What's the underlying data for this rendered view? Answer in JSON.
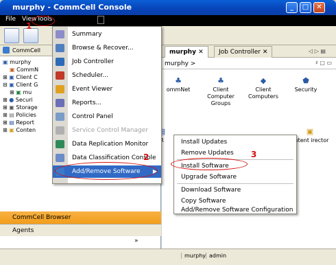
{
  "window": {
    "title": "murphy - CommCell Console",
    "minimize": "_",
    "maximize": "□",
    "close": "✕"
  },
  "menubar": {
    "file": "File",
    "view": "View",
    "tools": "Tools"
  },
  "left_panel": {
    "header": "CommCell",
    "tree": [
      "murphy",
      "CommN",
      "Client C",
      "Client G",
      "mu",
      "Securi",
      "Storage",
      "Policies",
      "Report",
      "Conten"
    ],
    "browser": "CommCell Browser",
    "agents": "Agents",
    "more": "»"
  },
  "tabs": [
    {
      "label": "murphy",
      "close": "✕"
    },
    {
      "label": "Job Controller",
      "close": "✕"
    }
  ],
  "tab_nav": "◁ ▷ ▤",
  "pane_controls": "♯ ▢ ▭",
  "breadcrumb": "murphy >",
  "right_icons": [
    {
      "label": "ommNet"
    },
    {
      "label": "Client Computer Groups"
    },
    {
      "label": "Client Computers"
    },
    {
      "label": "Security"
    },
    {
      "label": "R"
    },
    {
      "label": "ontent irector"
    }
  ],
  "tools_menu": [
    {
      "label": "Summary",
      "color": "#8b8cc8"
    },
    {
      "label": "Browse & Recover...",
      "color": "#4f7fbf"
    },
    {
      "label": "Job Controller",
      "color": "#2d6bb8"
    },
    {
      "label": "Scheduler...",
      "color": "#c0392b"
    },
    {
      "label": "Event Viewer",
      "color": "#e0a020"
    },
    {
      "label": "Reports...",
      "color": "#6a6fb8"
    },
    {
      "label": "Control Panel",
      "color": "#7a9cc8"
    },
    {
      "label": "Service Control Manager",
      "color": "#b0b0b0",
      "disabled": true
    },
    {
      "label": "Data Replication Monitor",
      "color": "#2e8b57"
    },
    {
      "label": "Data Classification Console",
      "color": "#6a8cc8"
    },
    {
      "label": "Add/Remove Software",
      "color": "#3c78c8",
      "highlighted": true,
      "arrow": "▶"
    }
  ],
  "submenu": [
    "Install Updates",
    "Remove Updates",
    "Install Software",
    "Upgrade Software",
    "Download Software",
    "Copy Software",
    "Add/Remove Software Configuration"
  ],
  "callouts": {
    "one": "1",
    "two": "2",
    "three": "3"
  },
  "status": {
    "user": "murphy",
    "role": "admin"
  }
}
